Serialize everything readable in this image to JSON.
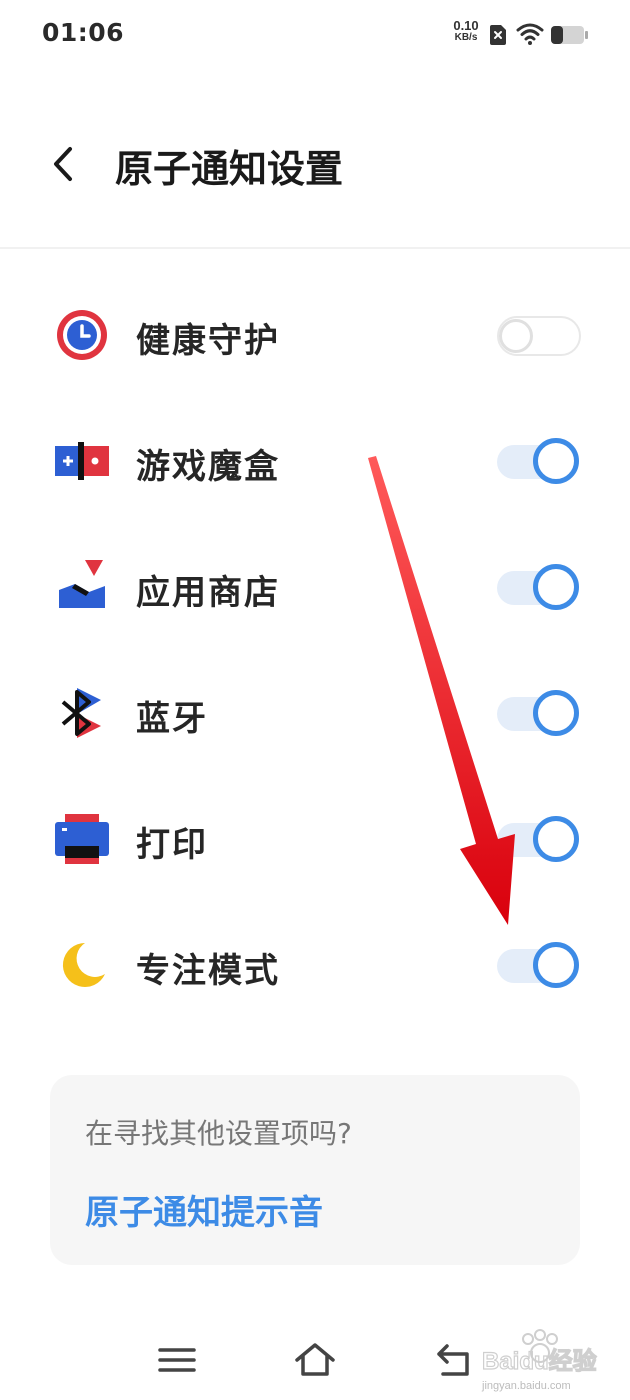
{
  "status_bar": {
    "time": "01:06",
    "net_speed_value": "0.10",
    "net_speed_unit": "KB/s",
    "icons": [
      "sim-off-icon",
      "wifi-icon",
      "battery-icon"
    ]
  },
  "header": {
    "back_icon": "chevron-left-icon",
    "title": "原子通知设置"
  },
  "settings": [
    {
      "label": "健康守护",
      "icon": "health-guard-icon",
      "enabled": false
    },
    {
      "label": "游戏魔盒",
      "icon": "game-box-icon",
      "enabled": true
    },
    {
      "label": "应用商店",
      "icon": "app-store-icon",
      "enabled": true
    },
    {
      "label": "蓝牙",
      "icon": "bluetooth-icon",
      "enabled": true
    },
    {
      "label": "打印",
      "icon": "printer-icon",
      "enabled": true
    },
    {
      "label": "专注模式",
      "icon": "focus-mode-moon-icon",
      "enabled": true
    }
  ],
  "card": {
    "question": "在寻找其他设置项吗?",
    "link": "原子通知提示音"
  },
  "nav_bar": {
    "icons": [
      "menu-icon",
      "home-icon",
      "back-icon"
    ]
  },
  "watermark": {
    "logo_text": "Baidu经验",
    "url_text": "jingyan.baidu.com"
  },
  "colors": {
    "accent": "#3d8be6",
    "toggle_track_on": "#e4edf9",
    "annotation_arrow": "#e8141c",
    "card_bg": "#f6f6f6"
  }
}
